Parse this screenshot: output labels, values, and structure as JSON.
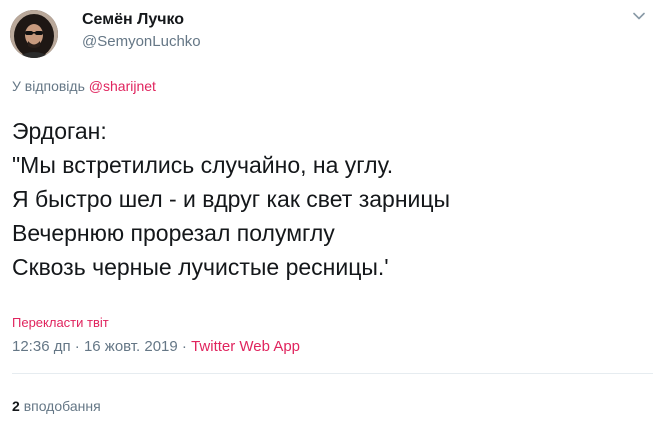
{
  "author": {
    "name": "Семён Лучко",
    "handle": "@SemyonLuchko",
    "avatar_icon": "avatar-portrait"
  },
  "menu": {
    "icon": "chevron-down-icon"
  },
  "reply": {
    "prefix": "У відповідь",
    "mention": "@sharijnet"
  },
  "tweet": {
    "lines": [
      "Эрдоган:",
      "\"Мы встретились случайно, на углу.",
      "Я быстро шел - и вдруг как свет зарницы",
      "Вечернюю прорезал полумглу",
      "Сквозь черные лучистые ресницы.'"
    ]
  },
  "translate": {
    "label": "Перекласти твіт"
  },
  "meta": {
    "time": "12:36 дп",
    "separator1": "·",
    "date": "16 жовт. 2019",
    "separator2": "·",
    "source": "Twitter Web App"
  },
  "stats": {
    "likes_count": "2",
    "likes_label": "вподобання"
  },
  "colors": {
    "accent": "#e0245e",
    "secondary_text": "#657786",
    "primary_text": "#14171a",
    "divider": "#e6ecf0"
  }
}
